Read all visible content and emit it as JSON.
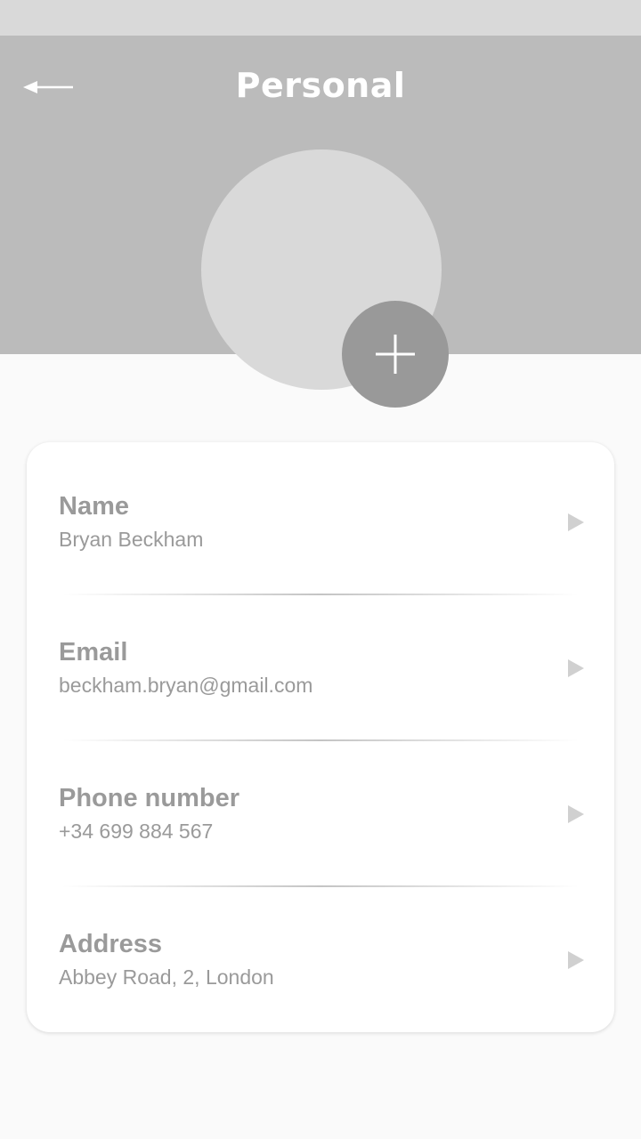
{
  "header": {
    "title": "Personal",
    "back_icon": "arrow-left-icon",
    "add_photo_icon": "plus-icon"
  },
  "colors": {
    "header_bg": "#bbbbbb",
    "status_bar_bg": "#d9d9d9",
    "avatar_bg": "#d9d9d9",
    "add_button_bg": "#999999",
    "text": "#9a9a9a"
  },
  "fields": [
    {
      "label": "Name",
      "value": "Bryan Beckham"
    },
    {
      "label": "Email",
      "value": "beckham.bryan@gmail.com"
    },
    {
      "label": "Phone number",
      "value": "+34 699 884 567"
    },
    {
      "label": "Address",
      "value": "Abbey Road, 2, London"
    }
  ]
}
